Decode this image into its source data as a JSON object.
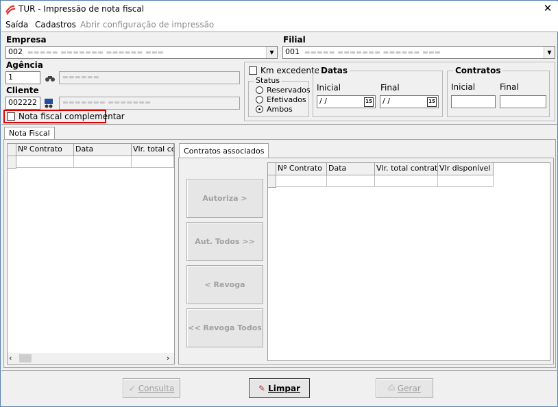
{
  "window": {
    "title": "TUR - Impressão de nota fiscal",
    "icon": "app-logo-icon",
    "close_icon": "close-icon"
  },
  "menu": [
    "Saída",
    "Cadastros",
    "Abrir configuração de impressão"
  ],
  "empresa": {
    "label": "Empresa",
    "value": "002"
  },
  "filial": {
    "label": "Filial",
    "value": "001"
  },
  "agencia": {
    "label": "Agência",
    "value": "1"
  },
  "cliente": {
    "label": "Cliente",
    "value": "002222"
  },
  "nota_complementar": {
    "label": "Nota fiscal complementar",
    "checked": false
  },
  "km_excedente": {
    "label": "Km excedente",
    "checked": false
  },
  "status": {
    "title": "Status",
    "options": [
      "Reservados",
      "Efetivados",
      "Ambos"
    ],
    "selected": "Ambos"
  },
  "datas": {
    "title": "Datas",
    "inicial_label": "Inicial",
    "final_label": "Final",
    "inicial_value": "/ /",
    "final_value": "/ /",
    "cal_label": "15"
  },
  "contratos": {
    "title": "Contratos",
    "inicial_label": "Inicial",
    "final_label": "Final"
  },
  "tabs": {
    "main": "Nota Fiscal",
    "associados": "Contratos associados"
  },
  "left_grid": {
    "columns": [
      "Nº Contrato",
      "Data",
      "Vlr. total cor"
    ]
  },
  "right_grid": {
    "columns": [
      "Nº Contrato",
      "Data",
      "Vlr. total contrato",
      "Vlr disponível"
    ]
  },
  "side_buttons": [
    "Autoriza >",
    "Aut. Todos >>",
    "< Revoga",
    "<< Revoga Todos"
  ],
  "bottom_buttons": {
    "consulta": "Consulta",
    "limpar": "Limpar",
    "gerar": "Gerar"
  },
  "colors": {
    "highlight_border": "#e00000",
    "accent": "#c0392b"
  }
}
